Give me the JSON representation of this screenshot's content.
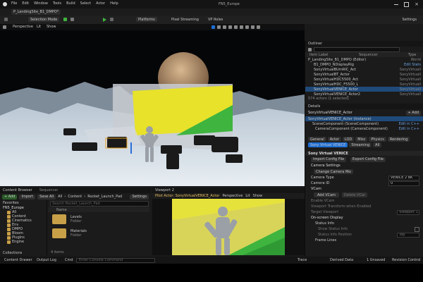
{
  "window": {
    "title": "FN5_Europe",
    "tab": "P_LandingSite_B1_DMPO*"
  },
  "menu": [
    "File",
    "Edit",
    "Window",
    "Tools",
    "Build",
    "Select",
    "Actor",
    "Help"
  ],
  "toolbar": {
    "mode": "Selection Mode",
    "platforms": "Platforms",
    "pixel_streaming": "Pixel Streaming",
    "vp_roles": "VP Roles",
    "settings": "Settings"
  },
  "viewport": {
    "perspective": "Perspective",
    "lit": "Lit",
    "show": "Show"
  },
  "outliner": {
    "title": "Outliner",
    "col_label": "Item Label",
    "col_type": "Type",
    "col_seq": "Sequencer",
    "rows": [
      {
        "label": "P_LandingSite_B1_DMPO (Editor)",
        "type": "World",
        "selected": false
      },
      {
        "label": "B1_DMPO_NDisplayRig",
        "type": "Edit Stats",
        "selected": false
      },
      {
        "label": "SonyVirtualBUrnRIC_Act",
        "type": "SonyVirtuall",
        "selected": false
      },
      {
        "label": "SonyVirtualBT_Actor",
        "type": "SonyVirtuall",
        "selected": false
      },
      {
        "label": "SonyVirtualHDC5500_Act",
        "type": "SonyVirtuall",
        "selected": false
      },
      {
        "label": "SonyVirtualHDC_F5500_L",
        "type": "SonyVirtuall",
        "selected": false
      },
      {
        "label": "SonyVirtualVENICE_Actor",
        "type": "SonyVirtuall",
        "selected": true
      },
      {
        "label": "SonyVirtualVENICE_Actor2",
        "type": "SonyVirtuall",
        "selected": false
      }
    ],
    "count": "574 actors (1 selected)"
  },
  "details": {
    "title": "Details",
    "actor_name": "SonyVirtualVENICE_Actor",
    "add": "+ Add",
    "instance": "SonyVirtualVENICE_Actor (Instance)",
    "components": [
      "SceneComponent (SceneComponent)",
      "CameraComponent (CameraComponent)"
    ],
    "edit_cpp": "Edit in C++",
    "tabs": [
      "General",
      "Actor",
      "LOD",
      "Misc",
      "Physics",
      "Rendering"
    ],
    "tabs2": [
      "Sony Virtual VENICE",
      "Streaming",
      "All"
    ],
    "section_main": "Sony Virtual VENICE",
    "import_cfg": "Import Config File",
    "export_cfg": "Export Config File",
    "cam_settings": "Camera Settings",
    "change_model": "Change Camera Model",
    "camera_type": "Camera Type",
    "camera_type_val": "VENICE 2 8K",
    "camera_id": "Camera ID",
    "camera_id_val": "0",
    "vcam": "VCam",
    "add_vcam": "Add VCam",
    "delete_vcam": "Delete VCam",
    "enable_vcam": "Enable VCam",
    "auto_vcam": "Viewport Transform when Enabled",
    "target_viewport": "Target Viewport",
    "target_viewport_val": "Viewport 1",
    "onscreen": "On-screen Display",
    "status_info": "Status Info",
    "show_status": "Show Status Info",
    "status_pos": "Status Info Position",
    "status_pos_val": "Top",
    "frame_lines": "Frame Lines"
  },
  "content_browser": {
    "title": "Content Browser",
    "sequencer": "Sequencer",
    "add": "+ Add",
    "import": "Import",
    "save_all": "Save All",
    "path": [
      "All",
      "Content",
      "Rocket_Launch_Pad"
    ],
    "settings": "Settings",
    "favorites": "Favorites",
    "project": "FN5_Europe",
    "tree": [
      "All",
      "Content",
      "Cinematics",
      "Env",
      "DMPO",
      "Bloom",
      "Plugins",
      "Engine"
    ],
    "search": "Search Rocket_Launch_Pad",
    "col_name": "Name",
    "folders": [
      {
        "name": "Levels",
        "kind": "Folder"
      },
      {
        "name": "Materials",
        "kind": "Folder"
      }
    ],
    "count": "4 items",
    "collections": "Collections"
  },
  "viewport2": {
    "tab": "Viewport 2",
    "pilot": "Pilot Actor: SonyVirtualVENICE_Actor",
    "perspective": "Perspective",
    "lit": "Lit",
    "show": "Show"
  },
  "status_bar": {
    "content_drawer": "Content Drawer",
    "output_log": "Output Log",
    "cmd": "Cmd",
    "console_placeholder": "Enter Console Command",
    "trace": "Trace",
    "derived_data": "Derived Data",
    "unsaved": "1 Unsaved",
    "revision": "Revision Control"
  },
  "colors": {
    "accent": "#1f6fd6",
    "green": "#3fb43f",
    "yellow": "#e8e22a"
  }
}
